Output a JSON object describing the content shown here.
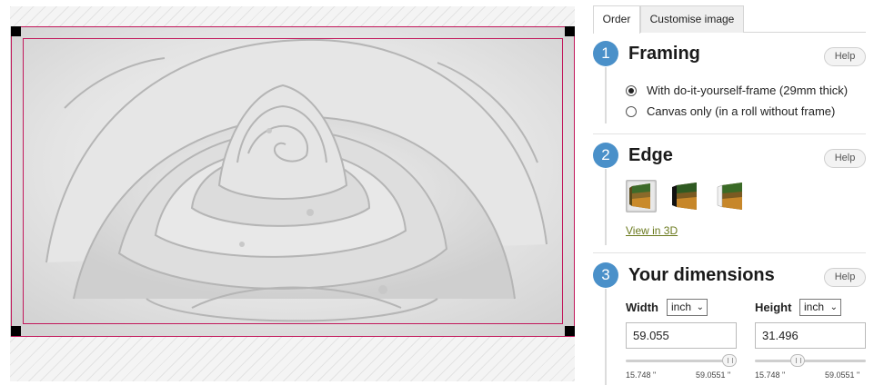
{
  "tabs": [
    {
      "label": "Order",
      "active": true
    },
    {
      "label": "Customise image",
      "active": false
    }
  ],
  "help_label": "Help",
  "framing": {
    "step": "1",
    "title": "Framing",
    "options": [
      {
        "label": "With do-it-yourself-frame (29mm thick)",
        "selected": true
      },
      {
        "label": "Canvas only (in a roll without frame)",
        "selected": false
      }
    ]
  },
  "edge": {
    "step": "2",
    "title": "Edge",
    "options": [
      "edge-wrap",
      "edge-dark",
      "edge-mirror"
    ],
    "selected": 0,
    "view3d_label": "View in 3D"
  },
  "dimensions": {
    "step": "3",
    "title": "Your dimensions",
    "width": {
      "label": "Width",
      "unit": "inch",
      "value": "59.055",
      "min_label": "15.748 \"",
      "max_label": "59.0551 \"",
      "slider_fraction": 1.0
    },
    "height": {
      "label": "Height",
      "unit": "inch",
      "value": "31.496",
      "min_label": "15.748 \"",
      "max_label": "59.0551 \"",
      "slider_fraction": 0.364
    }
  },
  "colors": {
    "accent_blue": "#4a90c9",
    "crop_frame": "#c2185b",
    "link_green": "#6b7a1e"
  }
}
